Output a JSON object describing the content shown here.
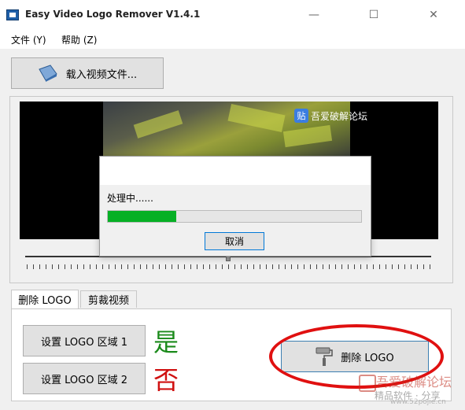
{
  "window": {
    "title": "Easy Video Logo Remover V1.4.1",
    "min_glyph": "—",
    "max_glyph": "☐",
    "close_glyph": "✕"
  },
  "menu": [
    "文件 (Y)",
    "帮助 (Z)"
  ],
  "load_button": {
    "label": "载入视频文件...",
    "icon": "book-icon"
  },
  "video": {
    "watermark_badge": "贴",
    "watermark_text": "吾爱破解论坛"
  },
  "progress_dialog": {
    "label": "处理中......",
    "progress_fraction": 0.27,
    "progress_color": "#06b025",
    "cancel_label": "取消"
  },
  "tabs": [
    {
      "label": "删除 LOGO",
      "active": true
    },
    {
      "label": "剪裁视频",
      "active": false
    }
  ],
  "logo_panel": {
    "area1_label": "设置 LOGO 区域 1",
    "area1_status": "是",
    "area1_status_color": "#1a8a1a",
    "area2_label": "设置 LOGO 区域 2",
    "area2_status": "否",
    "area2_status_color": "#d01010",
    "delete_label": "删除 LOGO",
    "delete_icon": "paint-roller-icon"
  },
  "corner_watermark": {
    "line1": "吾爱破解论坛",
    "line2": "精品软件 · 分享",
    "line3": "www.52pojie.cn"
  }
}
